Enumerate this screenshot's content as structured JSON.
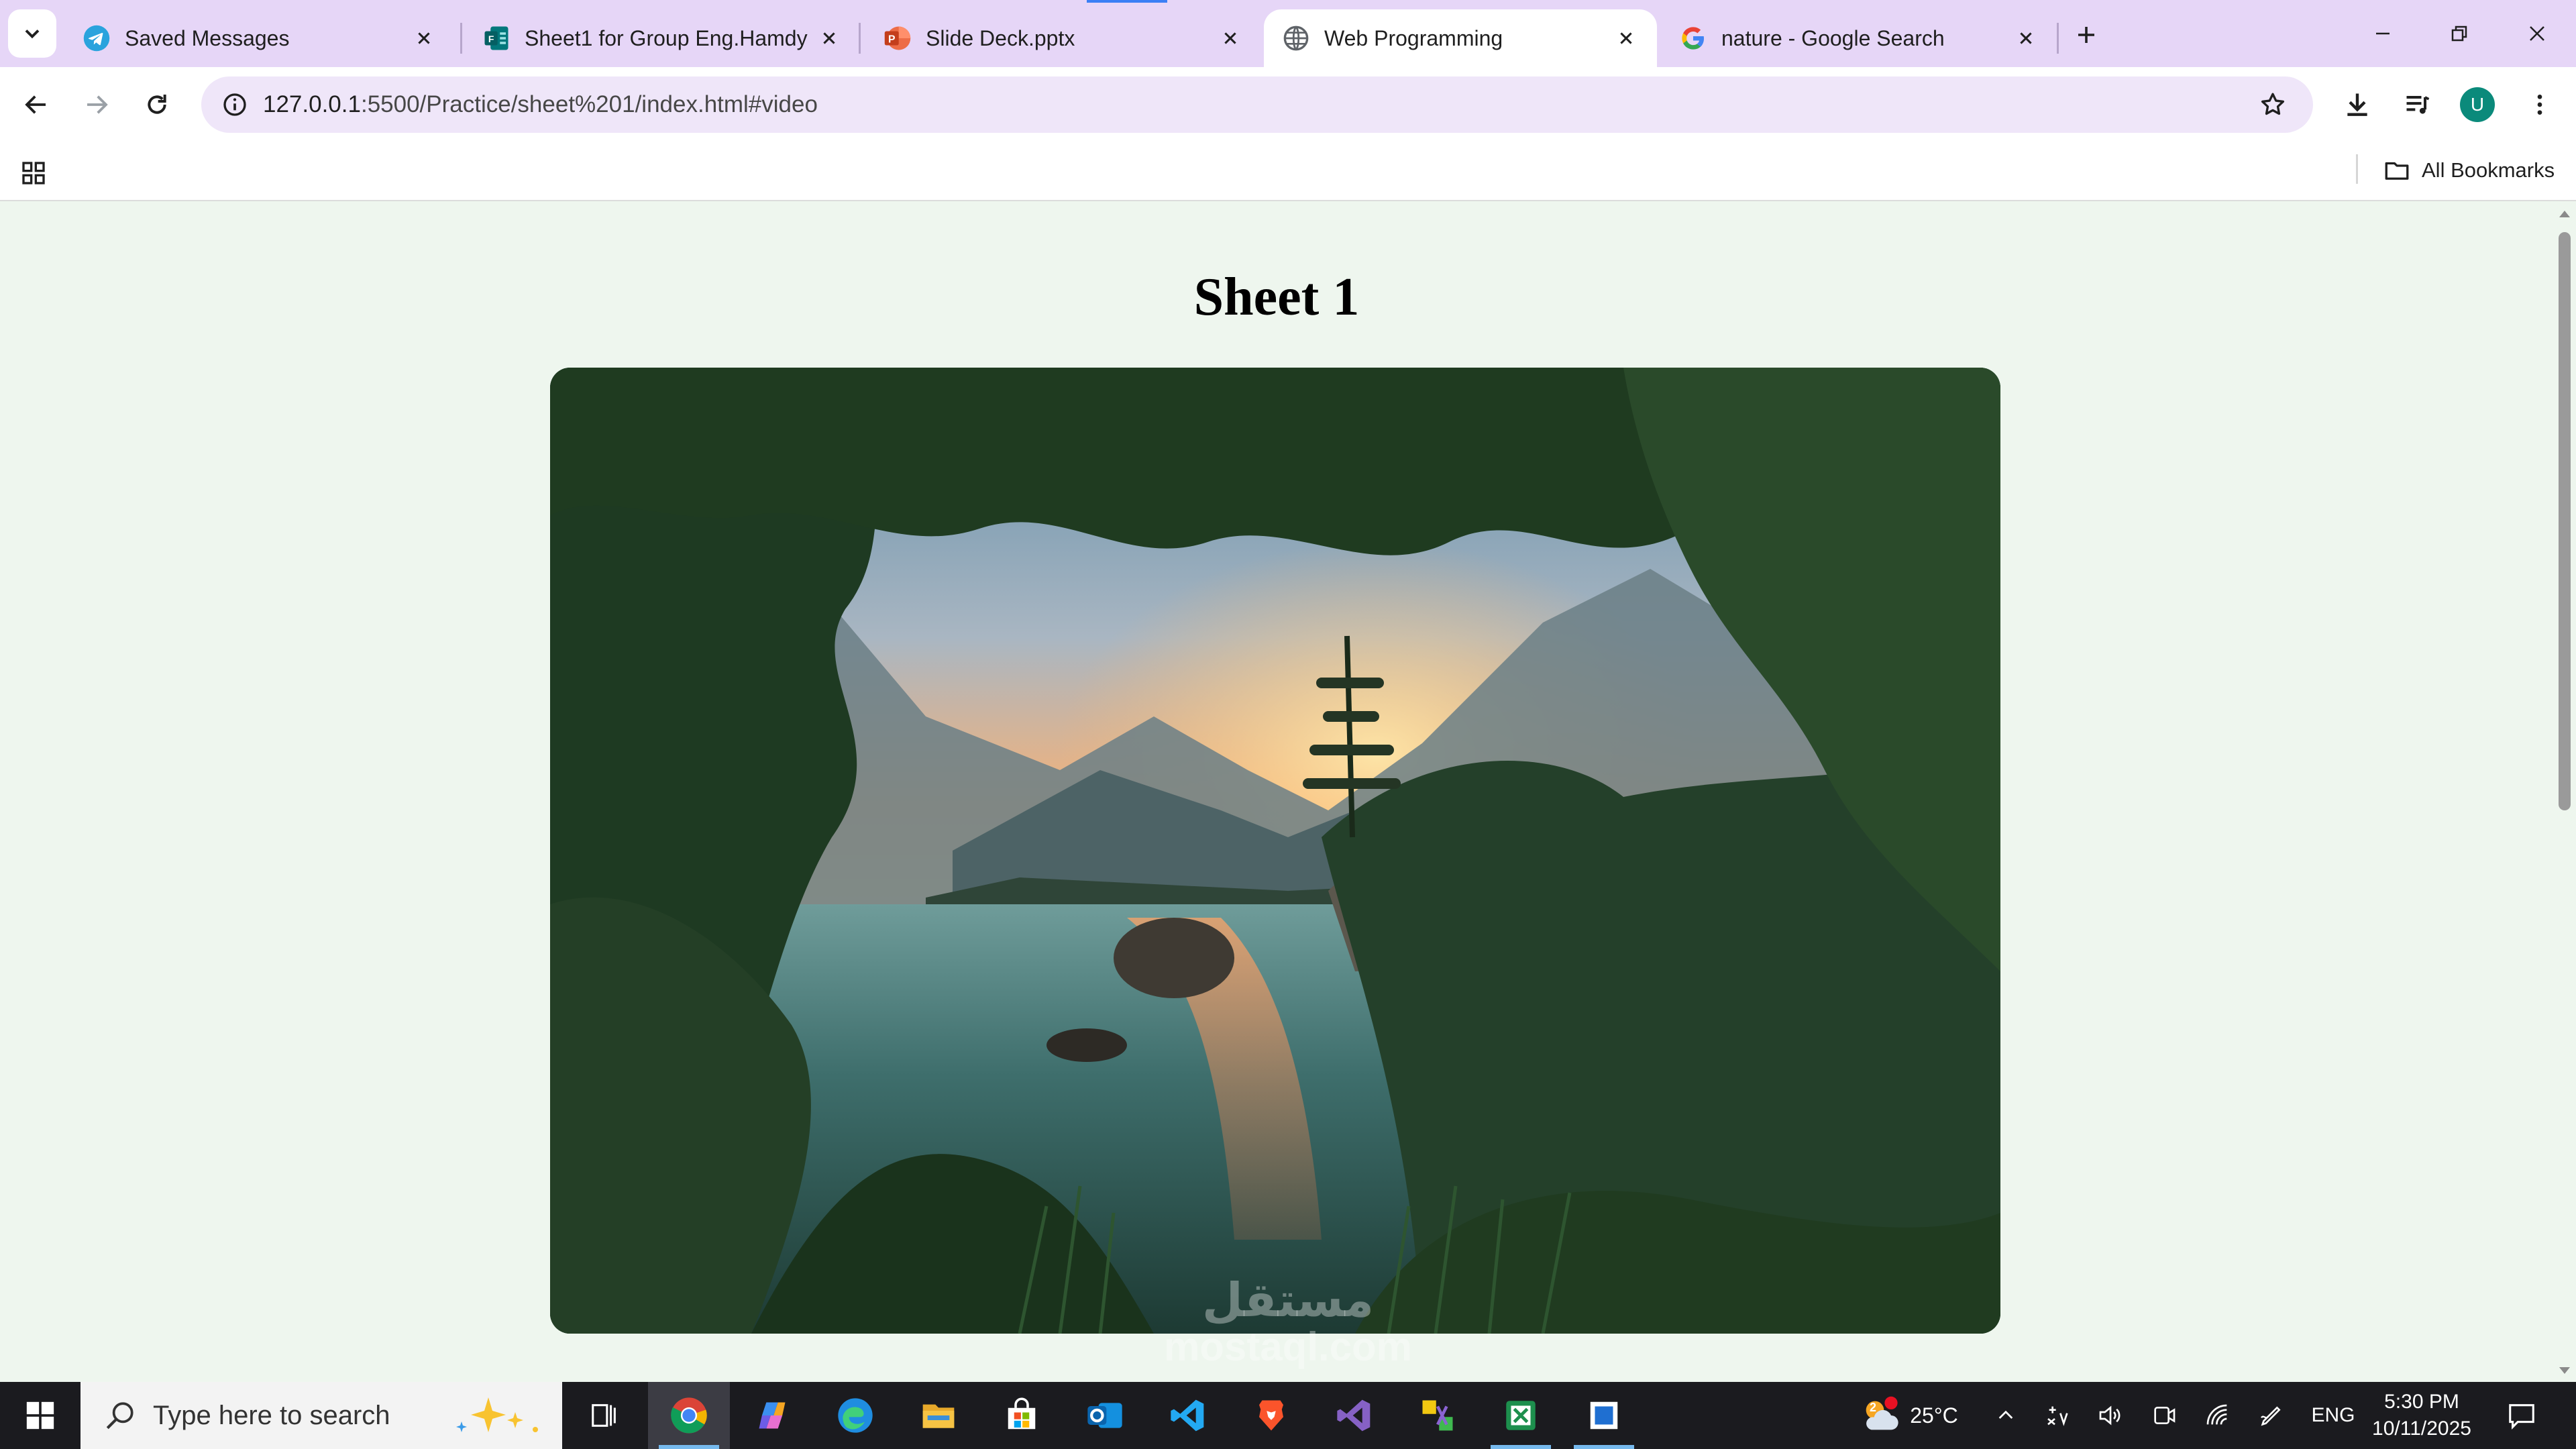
{
  "tabs": [
    {
      "title": "Saved Messages",
      "icon": "telegram-icon",
      "active": false
    },
    {
      "title": "Sheet1 for Group Eng.Hamdy",
      "icon": "forms-icon",
      "active": false
    },
    {
      "title": "Slide Deck.pptx",
      "icon": "powerpoint-icon",
      "active": false
    },
    {
      "title": "Web Programming",
      "icon": "globe-icon",
      "active": true
    },
    {
      "title": "nature - Google Search",
      "icon": "google-icon",
      "active": false
    }
  ],
  "toolbar": {
    "url_host": "127.0.0.1",
    "url_path": ":5500/Practice/sheet%201/index.html#video",
    "avatar_initial": "U"
  },
  "bookmarks": {
    "all_bookmarks_label": "All Bookmarks"
  },
  "page": {
    "title": "Sheet 1",
    "image": "nature-lake-sunset-image",
    "watermark_line1": "مستقل",
    "watermark_line2": "mostaql.com"
  },
  "taskbar": {
    "search_placeholder": "Type here to search",
    "weather_temp": "25°C",
    "weather_badge": "2",
    "language": "ENG",
    "time": "5:30 PM",
    "date": "10/11/2025",
    "apps": [
      "chrome-icon",
      "copilot-icon",
      "edge-icon",
      "file-explorer-icon",
      "microsoft-store-icon",
      "outlook-icon",
      "vscode-icon",
      "brave-icon",
      "visual-studio-icon",
      "app-icon",
      "excel-icon",
      "app-blue-icon"
    ]
  },
  "colors": {
    "tabstrip": "#e6d6f7",
    "omnibox": "#efe6f9",
    "page_bg": "#eef6ee",
    "taskbar": "#1b1b1f",
    "avatar": "#0b8a7b"
  }
}
